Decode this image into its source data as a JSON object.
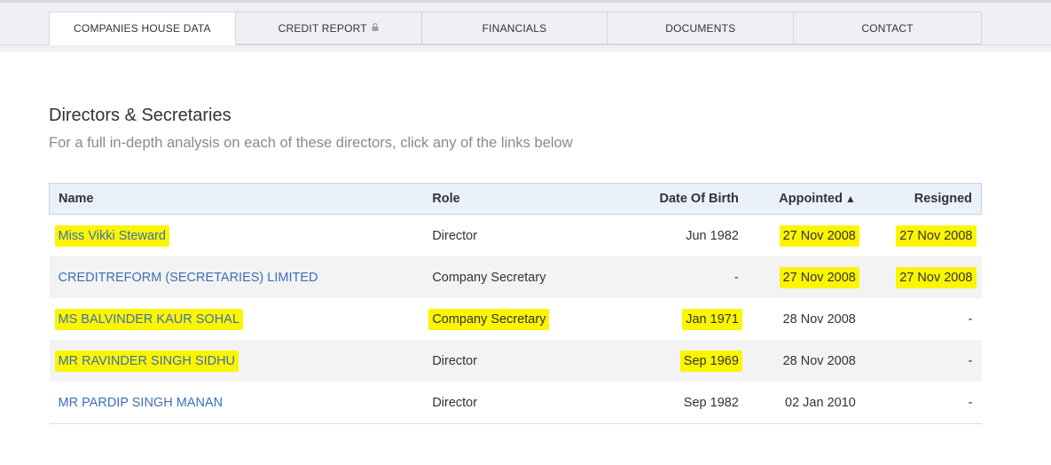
{
  "tabs": [
    {
      "label": "COMPANIES HOUSE DATA",
      "active": true
    },
    {
      "label": "CREDIT REPORT",
      "locked": true
    },
    {
      "label": "FINANCIALS"
    },
    {
      "label": "DOCUMENTS"
    },
    {
      "label": "CONTACT"
    }
  ],
  "section": {
    "title": "Directors & Secretaries",
    "subtitle": "For a full in-depth analysis on each of these directors, click any of the links below"
  },
  "table": {
    "headers": {
      "name": "Name",
      "role": "Role",
      "dob": "Date Of Birth",
      "appointed": "Appointed",
      "resigned": "Resigned"
    },
    "sort_indicator": "▲",
    "rows": [
      {
        "name": "Miss Vikki Steward",
        "role": "Director",
        "dob": "Jun 1982",
        "appointed": "27 Nov 2008",
        "resigned": "27 Nov 2008"
      },
      {
        "name": "CREDITREFORM (SECRETARIES) LIMITED",
        "role": "Company Secretary",
        "dob": "-",
        "appointed": "27 Nov 2008",
        "resigned": "27 Nov 2008"
      },
      {
        "name": "MS BALVINDER KAUR SOHAL",
        "role": "Company Secretary",
        "dob": "Jan 1971",
        "appointed": "28 Nov 2008",
        "resigned": "-"
      },
      {
        "name": "MR RAVINDER SINGH SIDHU",
        "role": "Director",
        "dob": "Sep 1969",
        "appointed": "28 Nov 2008",
        "resigned": "-"
      },
      {
        "name": "MR PARDIP SINGH MANAN",
        "role": "Director",
        "dob": "Sep 1982",
        "appointed": "02 Jan 2010",
        "resigned": "-"
      }
    ]
  },
  "colors": {
    "link": "#3d6fb6",
    "highlight": "#fbf500",
    "header_bg": "#ebf1fb"
  },
  "icons": {
    "credit_report_lock": "lock-icon"
  }
}
